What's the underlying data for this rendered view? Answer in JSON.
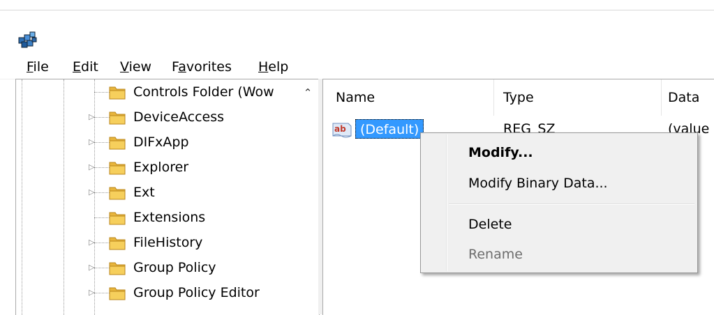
{
  "icons": {
    "app": "registry-editor-icon",
    "folder": "folder-icon",
    "value": "string-value-icon"
  },
  "menubar": [
    {
      "label": "File",
      "accel": "F",
      "rest": "ile"
    },
    {
      "label": "Edit",
      "accel": "E",
      "rest": "dit"
    },
    {
      "label": "View",
      "accel": "V",
      "rest": "iew"
    },
    {
      "label": "Favorites",
      "pre": "F",
      "accel": "a",
      "rest": "vorites"
    },
    {
      "label": "Help",
      "accel": "H",
      "rest": "elp"
    }
  ],
  "tree": {
    "items": [
      {
        "label": "Controls Folder (Wow",
        "expandable": false
      },
      {
        "label": "DeviceAccess",
        "expandable": true
      },
      {
        "label": "DIFxApp",
        "expandable": true
      },
      {
        "label": "Explorer",
        "expandable": true
      },
      {
        "label": "Ext",
        "expandable": true
      },
      {
        "label": "Extensions",
        "expandable": false
      },
      {
        "label": "FileHistory",
        "expandable": true
      },
      {
        "label": "Group Policy",
        "expandable": true
      },
      {
        "label": "Group Policy Editor",
        "expandable": true
      }
    ]
  },
  "list": {
    "columns": [
      "Name",
      "Type",
      "Data"
    ],
    "rows": [
      {
        "name": "(Default)",
        "type": "REG_SZ",
        "data": "(value"
      }
    ]
  },
  "context_menu": {
    "items": [
      {
        "label": "Modify...",
        "bold": true,
        "disabled": false
      },
      {
        "label": "Modify Binary Data...",
        "bold": false,
        "disabled": false
      },
      {
        "label": "Delete",
        "bold": false,
        "disabled": false
      },
      {
        "label": "Rename",
        "bold": false,
        "disabled": true
      }
    ]
  },
  "colors": {
    "selection": "#3399ff",
    "menu_bg": "#f0f0f0",
    "folder": "#e8b53c"
  }
}
